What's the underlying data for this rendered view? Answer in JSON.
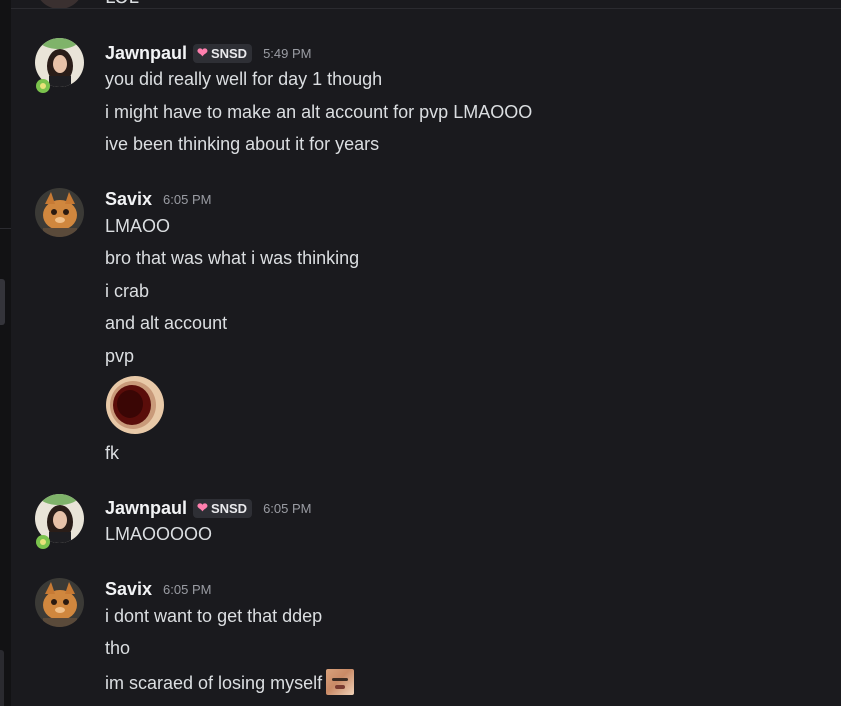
{
  "previous_message": {
    "text": "LOL"
  },
  "messages": [
    {
      "author": "Jawnpaul",
      "tag": {
        "icon": "heart-icon",
        "label": "SNSD"
      },
      "timestamp": "5:49 PM",
      "lines": [
        "you did really well for day 1 though",
        "i might have to make an alt account for pvp LMAOOO",
        "ive been thinking about it for years"
      ]
    },
    {
      "author": "Savix",
      "timestamp": "6:05 PM",
      "lines": [
        "LMAOO",
        "bro that was what i was thinking",
        "i crab",
        "and alt account",
        "pvp",
        "fk"
      ],
      "sticker": "open-mouth-emoji"
    },
    {
      "author": "Jawnpaul",
      "tag": {
        "icon": "heart-icon",
        "label": "SNSD"
      },
      "timestamp": "6:05 PM",
      "lines": [
        "LMAOOOOO"
      ]
    },
    {
      "author": "Savix",
      "timestamp": "6:05 PM",
      "lines": [
        "i dont want to get that ddep",
        "tho",
        "im scaraed of losing myself"
      ],
      "inline_emoji": "face-emoji"
    }
  ],
  "colors": {
    "background": "#1a1a1e",
    "text": "#dbdee1",
    "username": "#f2f3f5",
    "timestamp": "#9a9ca3",
    "tag_bg": "#2e2f35",
    "heart": "#ff7fae"
  }
}
